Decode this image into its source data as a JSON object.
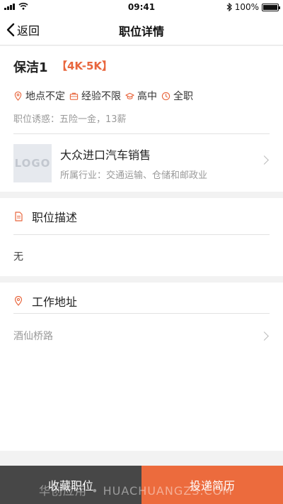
{
  "status_bar": {
    "time": "09:41",
    "battery_text": "100%",
    "battery_level": 1.0,
    "icons": [
      "signal-icon",
      "wifi-icon",
      "bluetooth-icon",
      "battery-icon"
    ]
  },
  "nav": {
    "back_label": "返回",
    "title": "职位详情"
  },
  "job": {
    "title": "保洁1",
    "salary": "【4K-5K】",
    "tags": [
      {
        "icon": "location-pin-icon",
        "label": "地点不定"
      },
      {
        "icon": "briefcase-icon",
        "label": "经验不限"
      },
      {
        "icon": "graduation-cap-icon",
        "label": "高中"
      },
      {
        "icon": "clock-icon",
        "label": "全职"
      }
    ],
    "perks": "职位诱惑：五险一金，13薪"
  },
  "company": {
    "logo_text": "LOGO",
    "name": "大众进口汽车销售",
    "industry": "所属行业：交通运输、仓储和邮政业"
  },
  "description": {
    "heading": "职位描述",
    "text": "无"
  },
  "address": {
    "heading": "工作地址",
    "text": "酒仙桥路"
  },
  "actions": {
    "favorite_label": "收藏职位",
    "apply_label": "投递简历"
  },
  "watermark": "华创应用 • HUACHUANGZS.COM",
  "colors": {
    "accent": "#e8663d",
    "apply_button": "#ec6b3d",
    "favorite_button": "#474747"
  }
}
